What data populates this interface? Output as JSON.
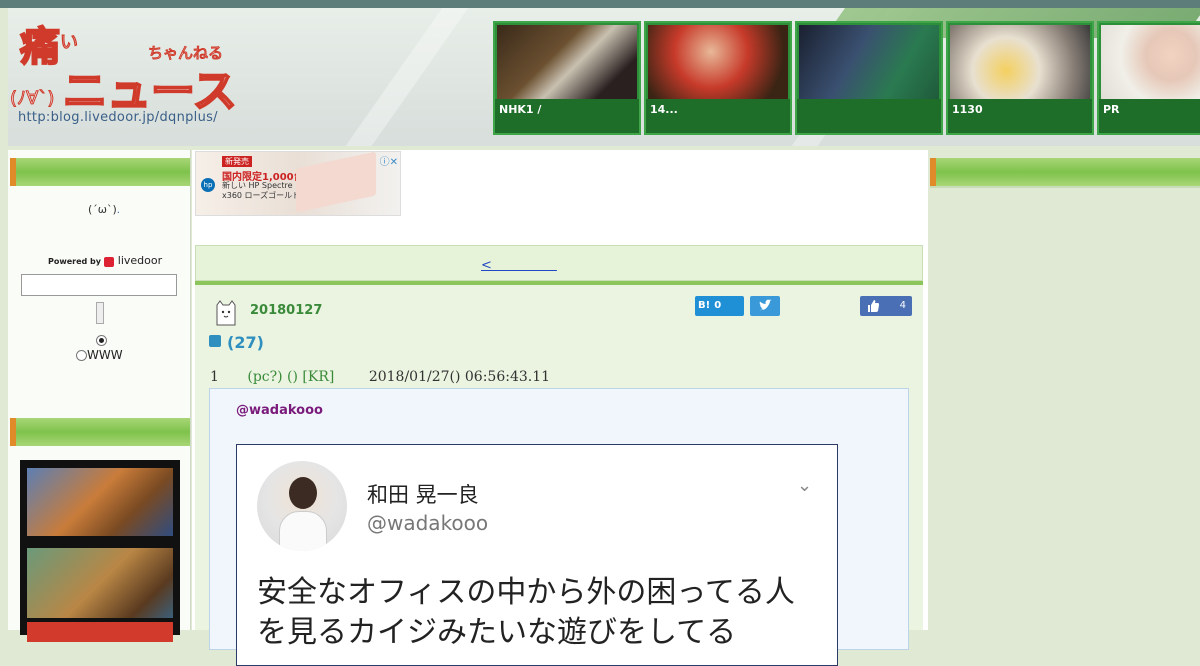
{
  "header": {
    "logo_text": "痛いニュース",
    "logo_sub": "ちゃんねる",
    "logo_face": "(ﾉ∀`)",
    "blog_url": "http:blog.livedoor.jp/dqnplus/",
    "thumbs": [
      {
        "caption": "NHK1 /"
      },
      {
        "caption": "14..."
      },
      {
        "caption": ""
      },
      {
        "caption": "1130"
      },
      {
        "caption": "PR"
      }
    ]
  },
  "sidebar": {
    "kaomoji": "(´ω`)",
    "kaomoji_link": ".",
    "powered_by": "Powered by",
    "brand": "livedoor",
    "search_value": "",
    "radio_site": "",
    "radio_www": "WWW"
  },
  "ad": {
    "badge": "新発売",
    "headline": "国内限定1,000台",
    "body": "新しい HP Spectre x360 ローズゴールド",
    "hp": "hp"
  },
  "nav": {
    "prev_link": "<　　　　　"
  },
  "article": {
    "date": "20180127",
    "title": "(27)",
    "hatena_count": "0",
    "fb_count": "4",
    "res": {
      "number": "1",
      "name": "(pc?) () [KR]",
      "timestamp": "2018/01/27() 06:56:43.11"
    },
    "handle": "@wadakooo",
    "tweet": {
      "name": "和田 晃一良",
      "handle": "@wadakooo",
      "text_line1": "安全なオフィスの中から外の困ってる人",
      "text_line2": "を見るカイジみたいな遊びをしてる"
    }
  }
}
